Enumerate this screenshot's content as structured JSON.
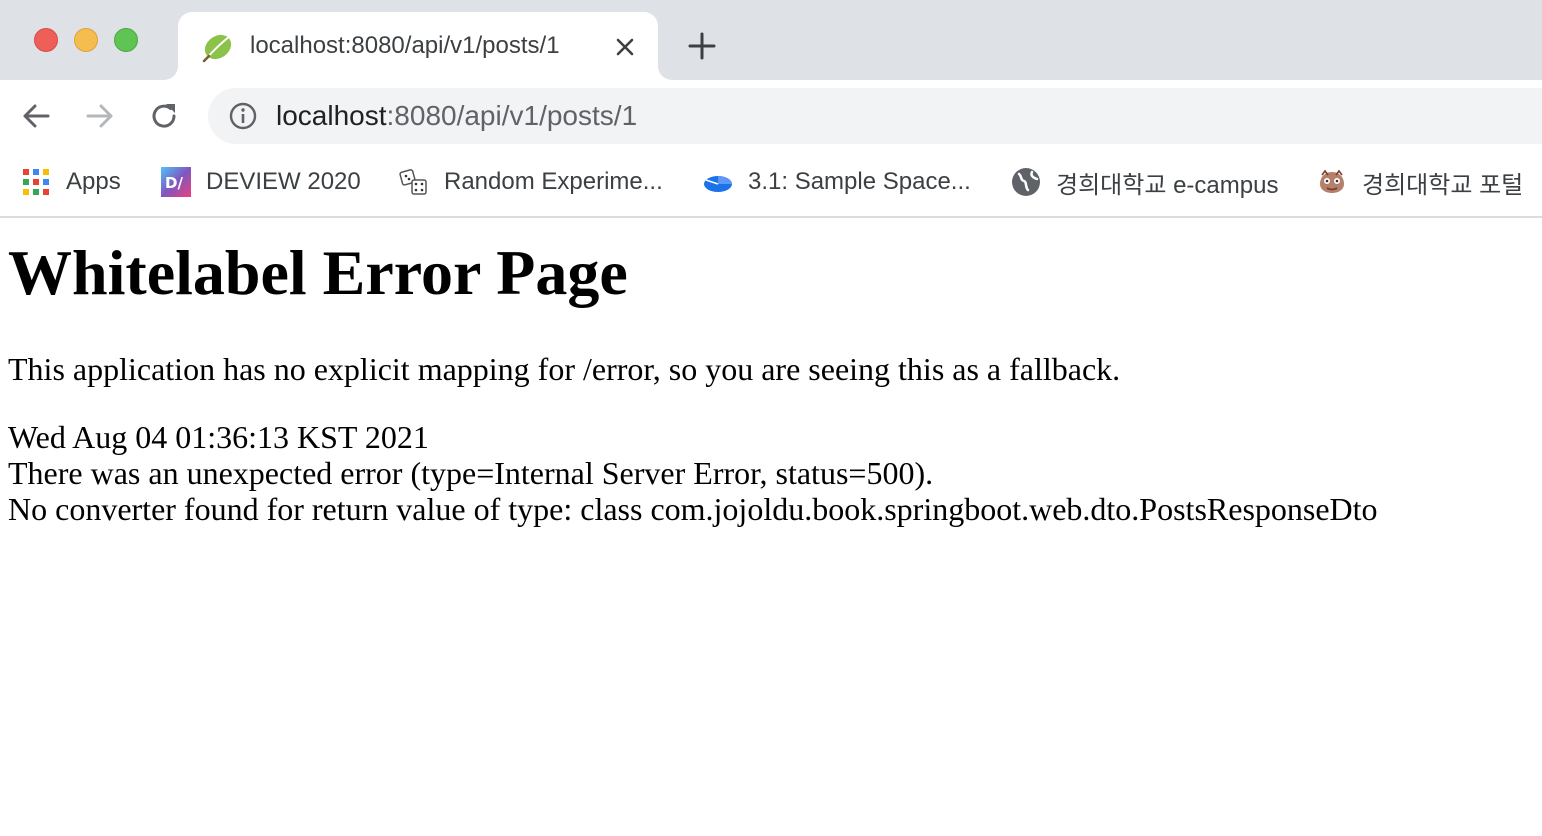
{
  "window": {
    "controls": [
      "close",
      "minimize",
      "maximize"
    ]
  },
  "tab": {
    "title": "localhost:8080/api/v1/posts/1",
    "favicon": "spring-leaf-icon",
    "close_icon": "close-icon",
    "new_tab_icon": "plus-icon"
  },
  "toolbar": {
    "back_icon": "back-arrow-icon",
    "forward_icon": "forward-arrow-icon",
    "reload_icon": "reload-icon",
    "site_info_icon": "info-icon",
    "url_host": "localhost",
    "url_rest": ":8080/api/v1/posts/1"
  },
  "bookmarks": [
    {
      "label": "Apps",
      "icon": "apps-grid-icon"
    },
    {
      "label": "DEVIEW 2020",
      "icon": "deview-icon"
    },
    {
      "label": "Random Experime...",
      "icon": "dice-icon"
    },
    {
      "label": "3.1: Sample Space...",
      "icon": "pie-chart-icon"
    },
    {
      "label": "경희대학교 e-campus",
      "icon": "globe-icon"
    },
    {
      "label": "경희대학교 포털",
      "icon": "university-crest-icon"
    }
  ],
  "page": {
    "heading": "Whitelabel Error Page",
    "description": "This application has no explicit mapping for /error, so you are seeing this as a fallback.",
    "timestamp": "Wed Aug 04 01:36:13 KST 2021",
    "error_line": "There was an unexpected error (type=Internal Server Error, status=500).",
    "message": "No converter found for return value of type: class com.jojoldu.book.springboot.web.dto.PostsResponseDto"
  },
  "colors": {
    "tabstrip_bg": "#dee1e6",
    "omnibox_bg": "#f1f3f4",
    "close_red": "#ee5f57",
    "minimize_yellow": "#f5bd4f",
    "maximize_green": "#5fc454",
    "spring_green": "#8bc34a"
  }
}
